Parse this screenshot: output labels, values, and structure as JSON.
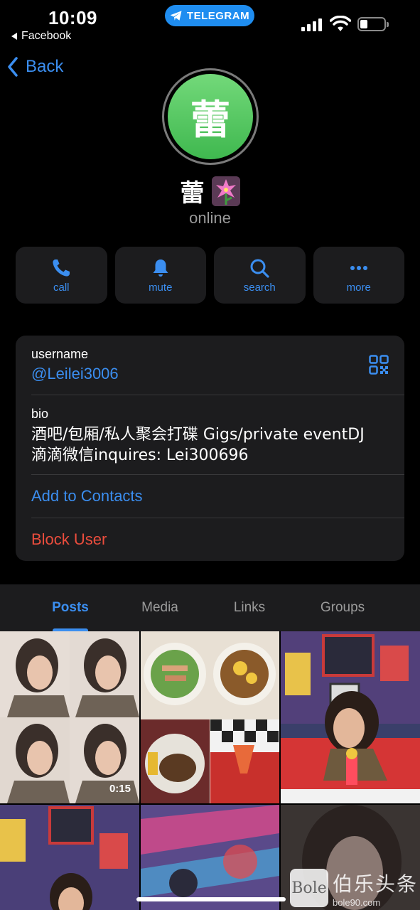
{
  "status_bar": {
    "time": "10:09",
    "back_app": "Facebook",
    "pill_label": "TELEGRAM",
    "battery_level": 0.3
  },
  "nav": {
    "back_label": "Back"
  },
  "profile": {
    "avatar_initial": "蕾",
    "name": "蕾",
    "status": "online",
    "avatar_color": "#4cc25a"
  },
  "actions": [
    {
      "label": "call",
      "icon": "phone-icon"
    },
    {
      "label": "mute",
      "icon": "bell-icon"
    },
    {
      "label": "search",
      "icon": "search-icon"
    },
    {
      "label": "more",
      "icon": "more-icon"
    }
  ],
  "info": {
    "username_label": "username",
    "username_value": "@Leilei3006",
    "bio_label": "bio",
    "bio_line1": "酒吧/包厢/私人聚会打碟 Gigs/private eventDJ",
    "bio_line2": "滴滴微信inquires: Lei300696",
    "add_contacts": "Add to Contacts",
    "block_user": "Block User"
  },
  "tabs": [
    {
      "label": "Posts",
      "active": true
    },
    {
      "label": "Media",
      "active": false
    },
    {
      "label": "Links",
      "active": false
    },
    {
      "label": "Groups",
      "active": false
    }
  ],
  "media": {
    "video_duration": "0:15"
  },
  "watermark": {
    "logo": "Bole",
    "cn": "伯乐头条",
    "url": "bole90.com"
  },
  "colors": {
    "accent": "#3b8ef0",
    "danger": "#eb4d3d",
    "card": "#1c1c1e"
  }
}
